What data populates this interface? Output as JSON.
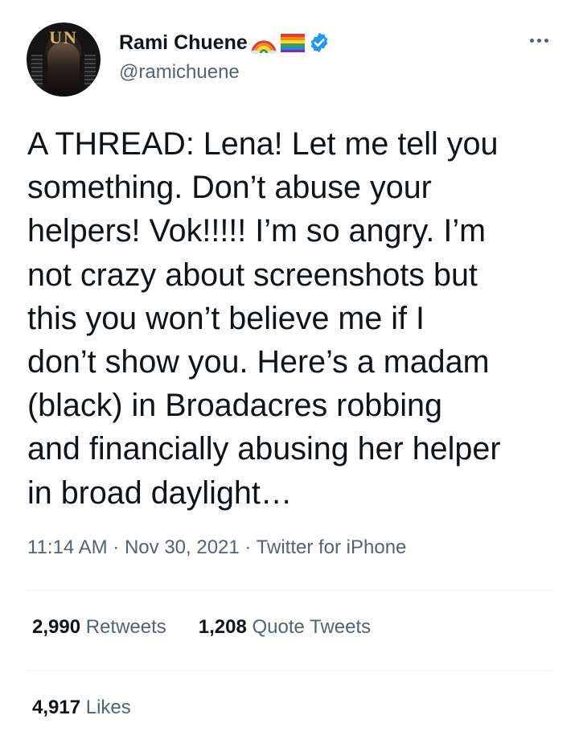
{
  "author": {
    "name": "Rami Chuene",
    "handle": "@ramichuene",
    "name_emojis": [
      "rainbow-icon",
      "rainbow-flag-icon"
    ],
    "verified": true,
    "avatar_text": "UN"
  },
  "tweet": {
    "text": "A THREAD: Lena! Let me tell you\nsomething. Don’t abuse your\nhelpers! Vok!!!!! I’m so angry. I’m\nnot crazy about screenshots but\nthis you won’t believe me if I\ndon’t show you. Here’s a madam\n(black) in Broadacres robbing\nand financially abusing her helper\nin broad daylight…",
    "time": "11:14 AM",
    "separator": "·",
    "date": "Nov 30, 2021",
    "source": "Twitter for iPhone"
  },
  "stats": {
    "retweets_count": "2,990",
    "retweets_label": "Retweets",
    "quotes_count": "1,208",
    "quotes_label": "Quote Tweets",
    "likes_count": "4,917",
    "likes_label": "Likes"
  },
  "colors": {
    "text": "#0f1419",
    "secondary": "#536471",
    "verified": "#1d9bf0",
    "divider": "#eff3f4"
  }
}
